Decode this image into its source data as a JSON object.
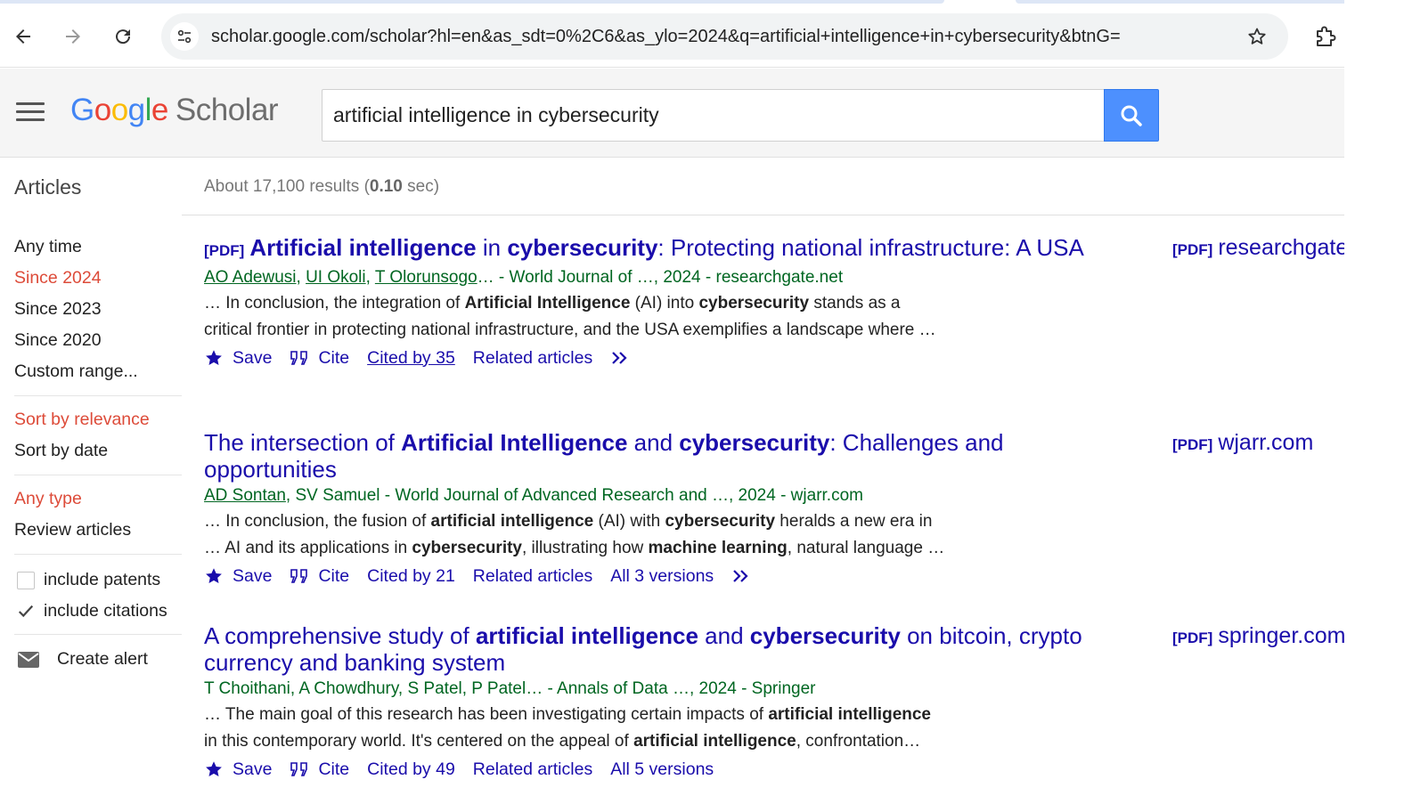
{
  "browser": {
    "url": "scholar.google.com/scholar?hl=en&as_sdt=0%2C6&as_ylo=2024&q=artificial+intelligence+in+cybersecurity&btnG="
  },
  "header": {
    "logo_letters": [
      "G",
      "o",
      "o",
      "g",
      "l",
      "e"
    ],
    "logo_scholar": "Scholar",
    "search_value": "artificial intelligence in cybersecurity"
  },
  "results_bar": {
    "articles_label": "Articles",
    "stats_prefix": "About 17,100 results (",
    "stats_time": "0.10",
    "stats_suffix": " sec)"
  },
  "sidebar": {
    "time": [
      "Any time",
      "Since 2024",
      "Since 2023",
      "Since 2020",
      "Custom range..."
    ],
    "sort": [
      "Sort by relevance",
      "Sort by date"
    ],
    "type": [
      "Any type",
      "Review articles"
    ],
    "include_patents": "include patents",
    "include_citations": "include citations",
    "create_alert": "Create alert"
  },
  "colors": {
    "active_filter": "#dd4b39",
    "link": "#1a0dab",
    "meta_green": "#006621",
    "search_button": "#4d90fe"
  },
  "results": [
    {
      "pdf_tag": "[PDF]",
      "title_parts": [
        {
          "t": "Artificial intelligence",
          "b": true
        },
        {
          "t": " in ",
          "b": false
        },
        {
          "t": "cybersecurity",
          "b": true
        },
        {
          "t": ": Protecting national infrastructure: A USA",
          "b": false
        }
      ],
      "authors": [
        "AO Adewusi",
        "UI Okoli",
        "T Olorunsogo"
      ],
      "authors_tail": "… - World Journal of …, 2024 - researchgate.net",
      "snippet_line1": [
        {
          "t": "… In conclusion, the integration of ",
          "b": false
        },
        {
          "t": "Artificial Intelligence",
          "b": true
        },
        {
          "t": " (AI) into ",
          "b": false
        },
        {
          "t": "cybersecurity",
          "b": true
        },
        {
          "t": " stands as a",
          "b": false
        }
      ],
      "snippet_line2": [
        {
          "t": "critical frontier in protecting national infrastructure, and the USA exemplifies a landscape where …",
          "b": false
        }
      ],
      "save": "Save",
      "cite": "Cite",
      "cited_by": "Cited by 35",
      "related": "Related articles",
      "versions": "",
      "side_tag": "[PDF]",
      "side_source": "researchgate.net"
    },
    {
      "pdf_tag": "",
      "title_parts": [
        {
          "t": "The intersection of ",
          "b": false
        },
        {
          "t": "Artificial Intelligence",
          "b": true
        },
        {
          "t": " and ",
          "b": false
        },
        {
          "t": "cybersecurity",
          "b": true
        },
        {
          "t": ": Challenges and opportunities",
          "b": false
        }
      ],
      "authors": [
        "AD Sontan"
      ],
      "authors_tail": ", SV Samuel - World Journal of Advanced Research and …, 2024 - wjarr.com",
      "snippet_line1": [
        {
          "t": "… In conclusion, the fusion of ",
          "b": false
        },
        {
          "t": "artificial intelligence",
          "b": true
        },
        {
          "t": " (AI) with ",
          "b": false
        },
        {
          "t": "cybersecurity",
          "b": true
        },
        {
          "t": " heralds a new era in",
          "b": false
        }
      ],
      "snippet_line2": [
        {
          "t": "… AI and its applications in ",
          "b": false
        },
        {
          "t": "cybersecurity",
          "b": true
        },
        {
          "t": ", illustrating how ",
          "b": false
        },
        {
          "t": "machine learning",
          "b": true
        },
        {
          "t": ", natural language …",
          "b": false
        }
      ],
      "save": "Save",
      "cite": "Cite",
      "cited_by": "Cited by 21",
      "related": "Related articles",
      "versions": "All 3 versions",
      "side_tag": "[PDF]",
      "side_source": "wjarr.com"
    },
    {
      "pdf_tag": "",
      "title_parts": [
        {
          "t": "A comprehensive study of ",
          "b": false
        },
        {
          "t": "artificial intelligence",
          "b": true
        },
        {
          "t": " and ",
          "b": false
        },
        {
          "t": "cybersecurity",
          "b": true
        },
        {
          "t": " on bitcoin, crypto currency and banking system",
          "b": false
        }
      ],
      "authors": [],
      "authors_tail": "T Choithani, A Chowdhury, S Patel, P Patel… - Annals of Data …, 2024 - Springer",
      "snippet_line1": [
        {
          "t": "… The main goal of this research has been investigating certain impacts of ",
          "b": false
        },
        {
          "t": "artificial intelligence",
          "b": true
        }
      ],
      "snippet_line2": [
        {
          "t": "in this contemporary world. It's centered on the appeal of ",
          "b": false
        },
        {
          "t": "artificial intelligence",
          "b": true
        },
        {
          "t": ", confrontation…",
          "b": false
        }
      ],
      "save": "Save",
      "cite": "Cite",
      "cited_by": "Cited by 49",
      "related": "Related articles",
      "versions": "All 5 versions",
      "side_tag": "[PDF]",
      "side_source": "springer.com"
    }
  ]
}
